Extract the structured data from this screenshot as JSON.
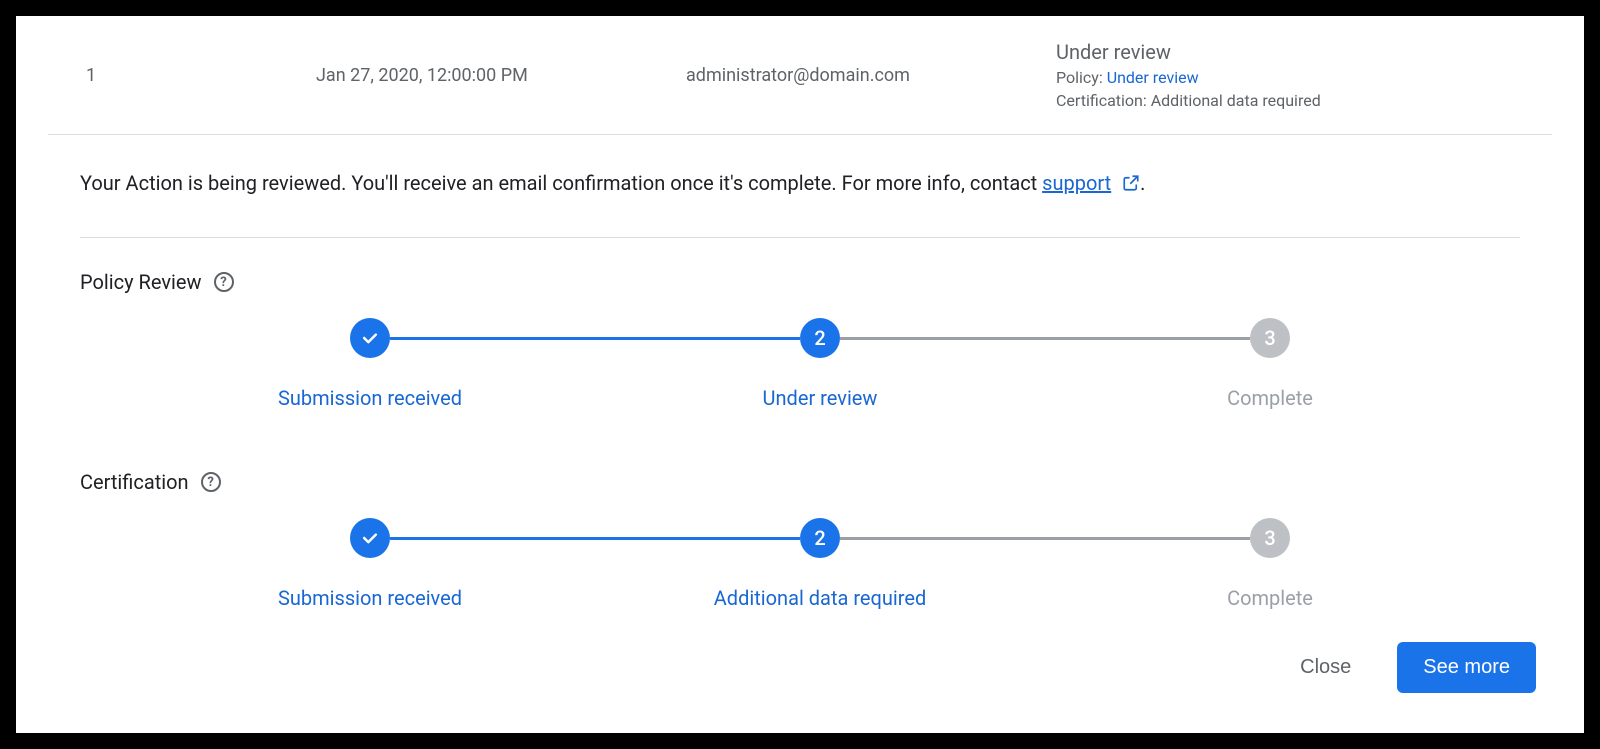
{
  "row": {
    "index": "1",
    "date": "Jan 27, 2020, 12:00:00 PM",
    "email": "administrator@domain.com",
    "status_title": "Under review",
    "policy_label": "Policy:",
    "policy_status": "Under review",
    "cert_label": "Certification:",
    "cert_status": "Additional data required"
  },
  "message": {
    "before": "Your Action is being reviewed. You'll receive an email confirmation once it's complete. For more info, contact ",
    "link": "support",
    "after": "."
  },
  "sections": {
    "policy": {
      "title": "Policy Review",
      "steps": [
        {
          "label": "Submission received",
          "state": "done"
        },
        {
          "label": "Under review",
          "state": "active",
          "num": "2"
        },
        {
          "label": "Complete",
          "state": "todo",
          "num": "3"
        }
      ]
    },
    "certification": {
      "title": "Certification",
      "steps": [
        {
          "label": "Submission received",
          "state": "done"
        },
        {
          "label": "Additional data required",
          "state": "active",
          "num": "2"
        },
        {
          "label": "Complete",
          "state": "todo",
          "num": "3"
        }
      ]
    }
  },
  "footer": {
    "close": "Close",
    "see_more": "See more"
  }
}
